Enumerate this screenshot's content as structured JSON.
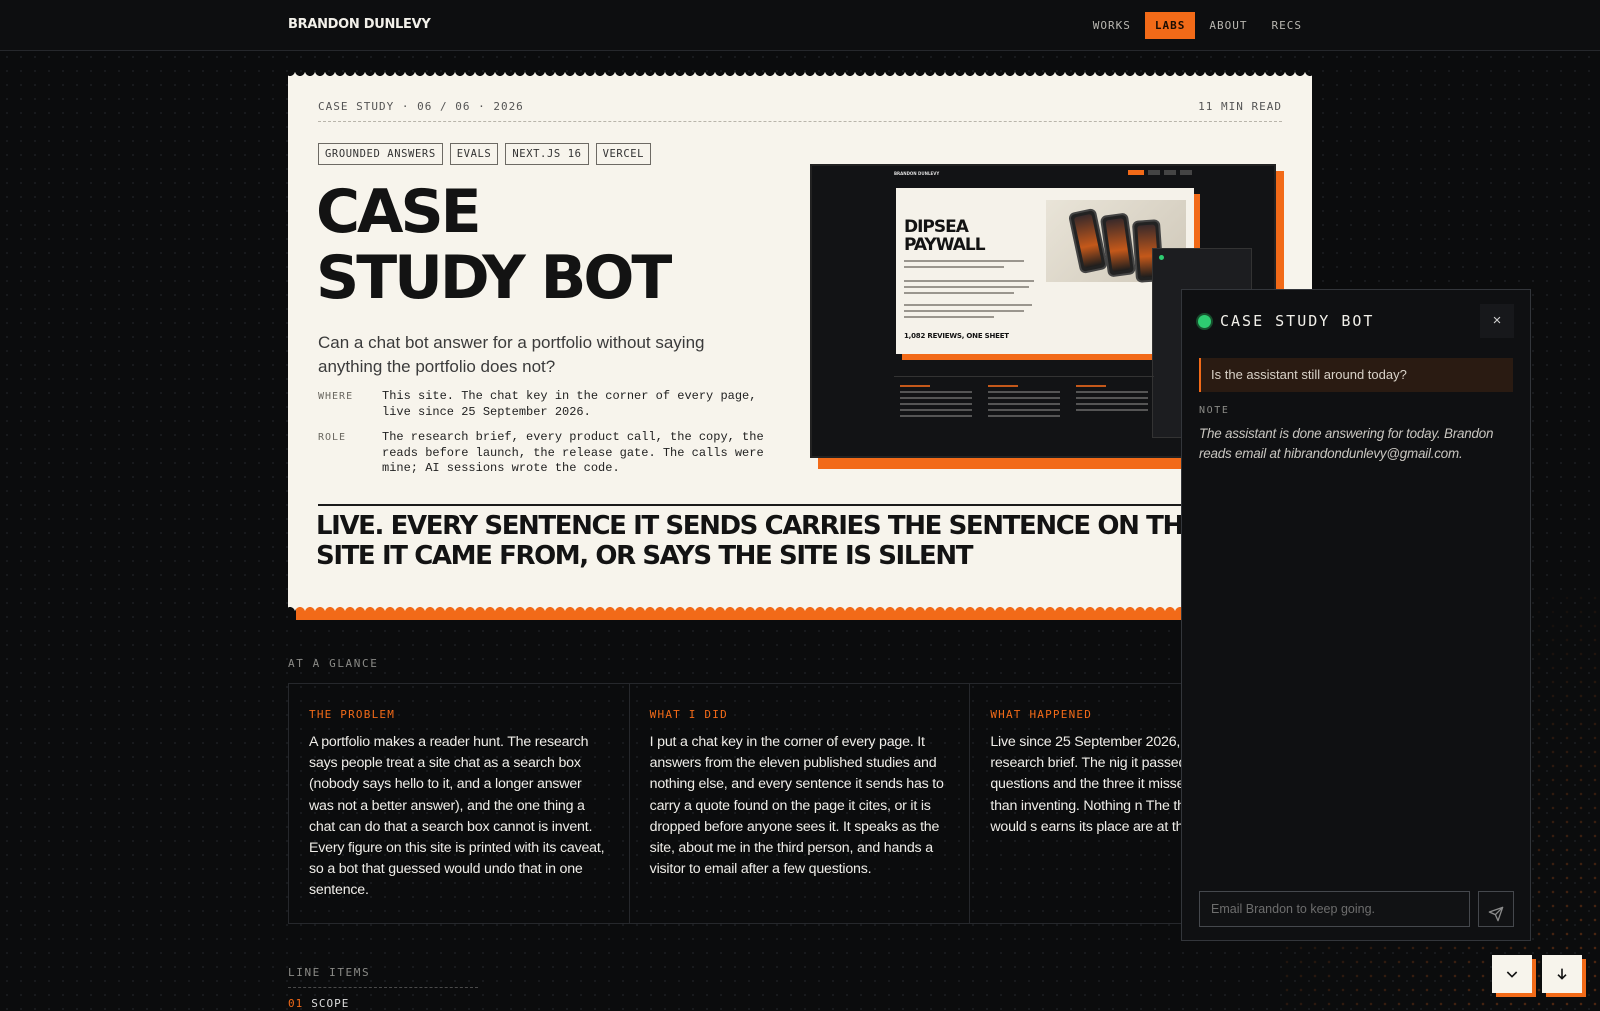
{
  "nav": {
    "brand": "BRANDON DUNLEVY",
    "links": [
      {
        "label": "WORKS",
        "active": false
      },
      {
        "label": "LABS",
        "active": true
      },
      {
        "label": "ABOUT",
        "active": false
      },
      {
        "label": "RECS",
        "active": false
      }
    ]
  },
  "case": {
    "meta_left": "CASE STUDY · 06 / 06 · 2026",
    "meta_right": "11 MIN READ",
    "tags": [
      "GROUNDED ANSWERS",
      "EVALS",
      "NEXT.JS 16",
      "VERCEL"
    ],
    "title_line1": "CASE",
    "title_line2": "STUDY BOT",
    "lede": "Can a chat bot answer for a portfolio without saying anything the portfolio does not?",
    "where_label": "WHERE",
    "where_value": "This site. The chat key in the corner of every page, live since 25 September 2026.",
    "role_label": "ROLE",
    "role_value": "The research brief, every product call, the copy, the reads before launch, the release gate. The calls were mine; AI sessions wrote the code.",
    "pull_quote": "LIVE. EVERY SENTENCE IT SENDS CARRIES THE SENTENCE ON THIS SITE IT CAME FROM, OR SAYS THE SITE IS SILENT"
  },
  "preview": {
    "brand": "BRANDON DUNLEVY",
    "title": "DIPSEA PAYWALL",
    "subtitle": "1,082 REVIEWS, ONE SHEET"
  },
  "glance": {
    "label": "AT A GLANCE",
    "columns": [
      {
        "heading": "THE PROBLEM",
        "body": "A portfolio makes a reader hunt. The research says people treat a site chat as a search box (nobody says hello to it, and a longer answer was not a better answer), and the one thing a chat can do that a search box cannot is invent. Every figure on this site is printed with its caveat, so a bot that guessed would undo that in one sentence."
      },
      {
        "heading": "WHAT I DID",
        "body": "I put a chat key in the corner of every page. It answers from the eleven published studies and nothing else, and every sentence it sends has to carry a quote found on the page it cites, or it is dropped before anyone sees it. It speaks as the site, about me in the third person, and hands a visitor to email after a few questions."
      },
      {
        "heading": "WHAT HAPPENED",
        "body": "Live since 25 September 2026, after the research brief. The nig it passed 48 of the 51 questions and the three it missed all went rather than inventing. Nothing n The three numbers that would s earns its place are at the foot."
      }
    ]
  },
  "line_items": {
    "label": "LINE ITEMS",
    "first_number": "01",
    "first_title": "SCOPE"
  },
  "chat": {
    "title": "CASE STUDY BOT",
    "close_glyph": "×",
    "user_message": "Is the assistant still around today?",
    "note_label": "NOTE",
    "note_text": "The assistant is done answering for today. Brandon reads email at hibrandondunlevy@gmail.com.",
    "input_placeholder": "Email Brandon to keep going.",
    "input_value": ""
  },
  "colors": {
    "accent": "#f26a18",
    "background": "#0b0c0d",
    "paper": "#f7f4ec",
    "status": "#2ecc71"
  },
  "icons": [
    "send-icon",
    "close-icon",
    "chevron-down-icon",
    "arrow-down-icon"
  ]
}
